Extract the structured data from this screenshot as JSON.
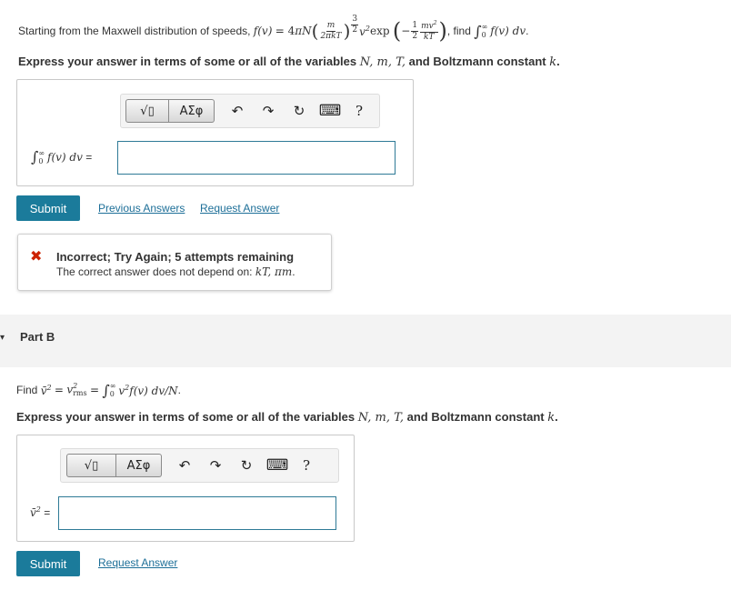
{
  "part_a": {
    "question_prefix": "Starting from the Maxwell distribution of speeds,",
    "question_mid": ", find",
    "math": {
      "f_of_v": "f(v)",
      "equals": "= 4",
      "pi": "π",
      "N": "N",
      "frac1_num": "m",
      "frac1_den": "2πkT",
      "exp_num": "3",
      "exp_den": "2",
      "v2": "v",
      "exp_word": "exp",
      "frac2_num_a": "1",
      "frac2_den_a": "2",
      "frac2_num_b": "mv",
      "frac2_den_b": "kT",
      "int_upper": "∞",
      "int_lower": "0",
      "integrand": "f(v) dv"
    },
    "question_end": ".",
    "instruction_prefix": "Express your answer in terms of some or all of the variables",
    "instruction_vars": "N, m, T,",
    "instruction_suffix": "and Boltzmann constant",
    "instruction_k": "k",
    "instruction_end": ".",
    "answer_label": "f(v) dv",
    "answer_eq": "=",
    "input_value": "",
    "submit_label": "Submit",
    "previous_answers_label": "Previous Answers",
    "request_answer_label": "Request Answer",
    "feedback": {
      "title": "Incorrect; Try Again; 5 attempts remaining",
      "message_prefix": "The correct answer does not depend on:",
      "message_vars": "kT, πm",
      "message_end": "."
    }
  },
  "toolbar": {
    "templates_label": "√▯",
    "symbols_label": "ΑΣφ",
    "undo": "↶",
    "redo": "↷",
    "reset": "↻",
    "keyboard": "⌨",
    "help": "?"
  },
  "part_b": {
    "title": "Part B",
    "question_prefix": "Find",
    "math": {
      "vbar2": "v̄",
      "eq1": "=",
      "vrms": "v",
      "rms": "rms",
      "eq2": "=",
      "int_upper": "∞",
      "int_lower": "0",
      "integrand": "v",
      "integrand_rest": "f(v) dv/N"
    },
    "question_end": ".",
    "instruction_prefix": "Express your answer in terms of some or all of the variables",
    "instruction_vars": "N, m, T,",
    "instruction_suffix": "and Boltzmann constant",
    "instruction_k": "k",
    "instruction_end": ".",
    "answer_label": "v̄",
    "answer_eq": "=",
    "input_value": "",
    "submit_label": "Submit",
    "request_answer_label": "Request Answer"
  },
  "colors": {
    "accent": "#1b7b9b",
    "link": "#1d6f98",
    "error": "#cc2200",
    "part_bar": "#f3f3f3"
  }
}
